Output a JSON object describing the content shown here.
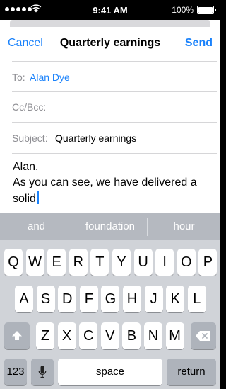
{
  "status_bar": {
    "time": "9:41 AM",
    "battery_percent": "100%",
    "battery_level": 1.0,
    "signal_dots": 5
  },
  "compose": {
    "cancel_label": "Cancel",
    "title": "Quarterly earnings",
    "send_label": "Send",
    "to_label": "To:",
    "to_value": "Alan Dye",
    "cc_label": "Cc/Bcc:",
    "subject_label": "Subject:",
    "subject_value": "Quarterly earnings",
    "body_lines": [
      "Alan,",
      "As you can see, we have delivered a",
      "solid"
    ]
  },
  "keyboard": {
    "suggestions": [
      "and",
      "foundation",
      "hour"
    ],
    "rows": [
      [
        "Q",
        "W",
        "E",
        "R",
        "T",
        "Y",
        "U",
        "I",
        "O",
        "P"
      ],
      [
        "A",
        "S",
        "D",
        "F",
        "G",
        "H",
        "J",
        "K",
        "L"
      ],
      [
        "Z",
        "X",
        "C",
        "V",
        "B",
        "N",
        "M"
      ]
    ],
    "numbers_label": "123",
    "space_label": "space",
    "return_label": "return",
    "shift_icon": "shift-arrow-icon",
    "delete_icon": "delete-backspace-icon",
    "mic_icon": "microphone-icon"
  },
  "colors": {
    "accent": "#1a82fb",
    "keyboard_bg": "#d0d3d8",
    "suggestion_bar": "#b5b9c0"
  }
}
